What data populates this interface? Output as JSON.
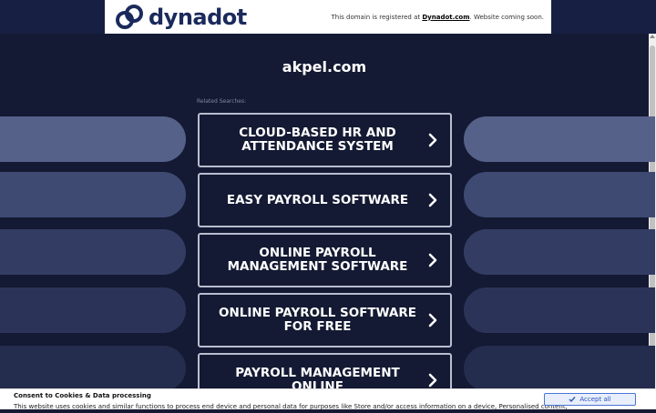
{
  "banner": {
    "brand": "dynadot",
    "notice_prefix": "This domain is registered at ",
    "notice_link": "Dynadot.com",
    "notice_suffix": ". Website coming soon."
  },
  "main": {
    "domain": "akpel.com",
    "related_label": "Related Searches:",
    "links": [
      {
        "label": "CLOUD-BASED HR AND ATTENDANCE SYSTEM"
      },
      {
        "label": "EASY PAYROLL SOFTWARE"
      },
      {
        "label": "ONLINE PAYROLL MANAGEMENT SOFTWARE"
      },
      {
        "label": "ONLINE PAYROLL SOFTWARE FOR FREE"
      },
      {
        "label": "PAYROLL MANAGEMENT ONLINE"
      }
    ]
  },
  "cookie": {
    "title": "Consent to Cookies & Data processing",
    "text": "This website uses cookies and similar functions to process end device and personal data for purposes like Store and/or access information on a device, Personalised content,",
    "accept_label": "Accept all"
  },
  "icons": {
    "chevron": "chevron-right-icon",
    "brand_logo": "dynadot-logo-icon",
    "accept": "check-icon"
  },
  "colors": {
    "background": "#141a33",
    "brand": "#1b2a5c",
    "accent": "#4a74d4"
  }
}
